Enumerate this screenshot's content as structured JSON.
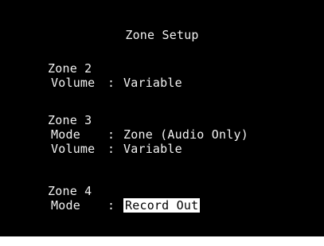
{
  "screen": {
    "title": "Zone Setup",
    "zones": [
      {
        "name": "Zone 2",
        "settings": [
          {
            "label": "Volume",
            "separator": ":",
            "value": "Variable"
          }
        ]
      },
      {
        "name": "Zone 3",
        "settings": [
          {
            "label": "Mode",
            "separator": ":",
            "value": "Zone (Audio Only)"
          },
          {
            "label": "Volume",
            "separator": ":",
            "value": "Variable"
          }
        ]
      },
      {
        "name": "Zone 4",
        "settings": [
          {
            "label": "Mode",
            "separator": ":",
            "value": "Record Out",
            "selected": true
          }
        ]
      }
    ]
  },
  "colors": {
    "background": "#000000",
    "text": "#f2f2f2",
    "highlight_bg": "#ffffff",
    "highlight_text": "#000000"
  }
}
